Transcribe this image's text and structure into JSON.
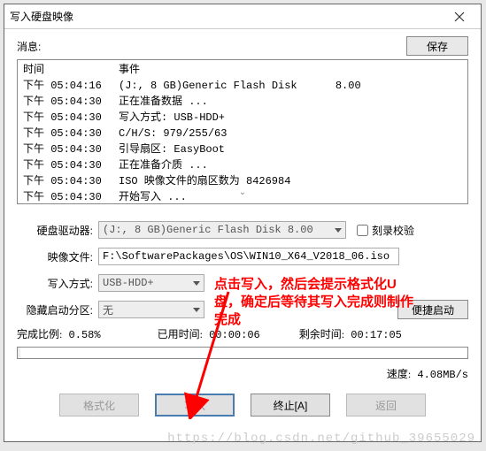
{
  "window": {
    "title": "写入硬盘映像"
  },
  "info": {
    "label": "消息:",
    "save_btn": "保存"
  },
  "log": {
    "header_time": "时间",
    "header_event": "事件",
    "rows": [
      {
        "time": "下午 05:04:16",
        "event": "(J:, 8 GB)Generic Flash Disk      8.00"
      },
      {
        "time": "下午 05:04:30",
        "event": "正在准备数据 ..."
      },
      {
        "time": "下午 05:04:30",
        "event": "写入方式: USB-HDD+"
      },
      {
        "time": "下午 05:04:30",
        "event": "C/H/S: 979/255/63"
      },
      {
        "time": "下午 05:04:30",
        "event": "引导扇区: EasyBoot"
      },
      {
        "time": "下午 05:04:30",
        "event": "正在准备介质 ..."
      },
      {
        "time": "下午 05:04:30",
        "event": "ISO 映像文件的扇区数为 8426984"
      },
      {
        "time": "下午 05:04:30",
        "event": "开始写入 ..."
      }
    ]
  },
  "form": {
    "drive_label": "硬盘驱动器:",
    "drive_value": "(J:, 8 GB)Generic Flash Disk      8.00",
    "verify_label": "刻录校验",
    "image_label": "映像文件:",
    "image_value": "F:\\SoftwarePackages\\OS\\WIN10_X64_V2018_06.iso",
    "write_mode_label": "写入方式:",
    "write_mode_value": "USB-HDD+",
    "hidden_label": "隐藏启动分区:",
    "hidden_value": "无",
    "quick_boot_btn": "便捷启动"
  },
  "progress": {
    "done_label": "完成比例:",
    "done_value": "0.58%",
    "elapsed_label": "已用时间:",
    "elapsed_value": "00:00:06",
    "remain_label": "剩余时间:",
    "remain_value": "00:17:05",
    "speed_label": "速度:",
    "speed_value": "4.08MB/s"
  },
  "buttons": {
    "format": "格式化",
    "write": "写入",
    "abort": "终止[A]",
    "back": "返回"
  },
  "annotation": {
    "text": "点击写入，然后会提示格式化U盘，确定后等待其写入完成则制作完成"
  },
  "watermark": "https://blog.csdn.net/github_39655029"
}
